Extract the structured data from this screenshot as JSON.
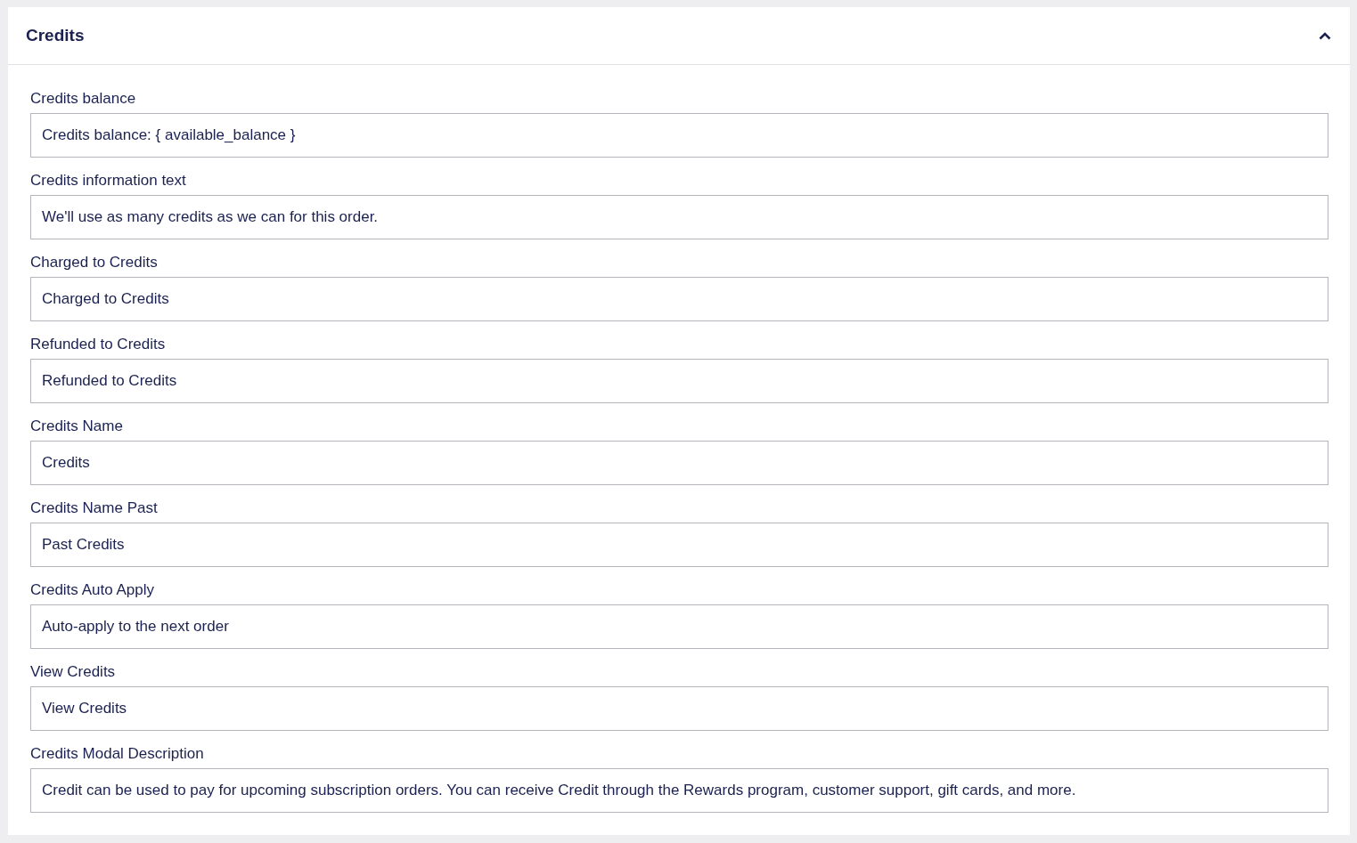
{
  "panel": {
    "title": "Credits",
    "expanded": true
  },
  "fields": [
    {
      "label": "Credits balance",
      "value": "Credits balance: { available_balance }"
    },
    {
      "label": "Credits information text",
      "value": "We'll use as many credits as we can for this order."
    },
    {
      "label": "Charged to Credits",
      "value": "Charged to Credits"
    },
    {
      "label": "Refunded to Credits",
      "value": "Refunded to Credits"
    },
    {
      "label": "Credits Name",
      "value": "Credits"
    },
    {
      "label": "Credits Name Past",
      "value": "Past Credits"
    },
    {
      "label": "Credits Auto Apply",
      "value": "Auto-apply to the next order"
    },
    {
      "label": "View Credits",
      "value": "View Credits"
    },
    {
      "label": "Credits Modal Description",
      "value": "Credit can be used to pay for upcoming subscription orders. You can receive Credit through the Rewards program, customer support, gift cards, and more."
    }
  ]
}
